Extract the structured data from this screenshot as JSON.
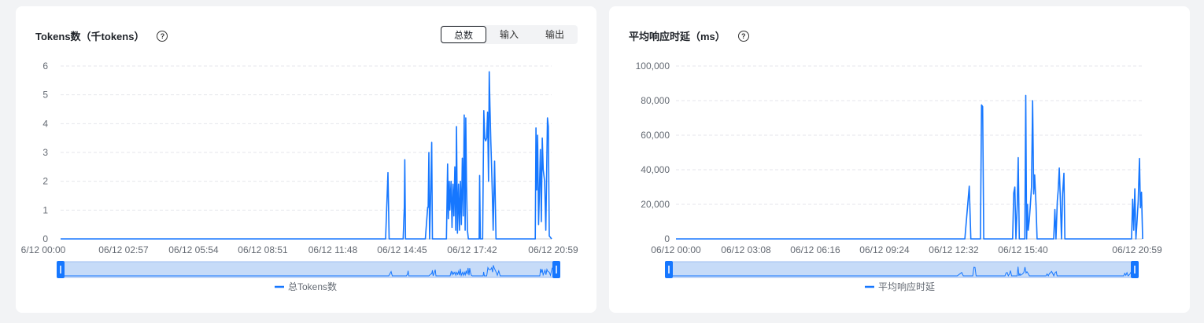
{
  "panels": {
    "tokens": {
      "title": "Tokens数（千tokens）",
      "help_icon": "question-circle-icon",
      "tabs": [
        {
          "label": "总数",
          "active": true
        },
        {
          "label": "输入",
          "active": false
        },
        {
          "label": "输出",
          "active": false
        }
      ]
    },
    "latency": {
      "title": "平均响应时延（ms）",
      "help_icon": "question-circle-icon"
    }
  },
  "colors": {
    "series": "#1677ff",
    "slider_fill": "#c6dbf8",
    "grid": "#e5e6eb"
  },
  "chart_data": [
    {
      "type": "line",
      "title": "Tokens数（千tokens）",
      "xlabel": "",
      "ylabel": "",
      "x_ticks": [
        "6/12 00:00",
        "06/12 02:57",
        "06/12 05:54",
        "06/12 08:51",
        "06/12 11:48",
        "06/12 14:45",
        "06/12 17:42",
        "06/12 20:59"
      ],
      "y_ticks": [
        "0",
        "1",
        "2",
        "3",
        "4",
        "5",
        "6"
      ],
      "ylim": [
        0,
        6
      ],
      "x_range_hours": [
        0,
        21
      ],
      "grid": "dashed-horizontal",
      "legend_position": "bottom",
      "series": [
        {
          "name": "总Tokens数",
          "points": [
            [
              0,
              0
            ],
            [
              13.9,
              0
            ],
            [
              14.0,
              2.3
            ],
            [
              14.05,
              0
            ],
            [
              14.65,
              0
            ],
            [
              14.7,
              1.1
            ],
            [
              14.72,
              2.75
            ],
            [
              14.75,
              0
            ],
            [
              15.6,
              0
            ],
            [
              15.7,
              1.1
            ],
            [
              15.72,
              1.1
            ],
            [
              15.75,
              3.0
            ],
            [
              15.78,
              0
            ],
            [
              15.83,
              1.7
            ],
            [
              15.87,
              3.35
            ],
            [
              15.9,
              0
            ],
            [
              16.5,
              0
            ],
            [
              16.55,
              2.6
            ],
            [
              16.58,
              0.7
            ],
            [
              16.62,
              2.0
            ],
            [
              16.65,
              1.0
            ],
            [
              16.7,
              2.0
            ],
            [
              16.74,
              0.4
            ],
            [
              16.78,
              1.9
            ],
            [
              16.82,
              0.8
            ],
            [
              16.86,
              2.5
            ],
            [
              16.9,
              0.3
            ],
            [
              16.93,
              3.9
            ],
            [
              16.97,
              0.2
            ],
            [
              17.02,
              1.9
            ],
            [
              17.06,
              0.3
            ],
            [
              17.1,
              2.0
            ],
            [
              17.14,
              0.5
            ],
            [
              17.18,
              2.8
            ],
            [
              17.22,
              0.8
            ],
            [
              17.26,
              4.3
            ],
            [
              17.3,
              0.3
            ],
            [
              17.33,
              4.2
            ],
            [
              17.36,
              1.9
            ],
            [
              17.4,
              0.3
            ],
            [
              17.44,
              0
            ],
            [
              17.9,
              0
            ],
            [
              17.92,
              2.2
            ],
            [
              17.95,
              0
            ],
            [
              18.05,
              0
            ],
            [
              18.1,
              4.45
            ],
            [
              18.14,
              3.5
            ],
            [
              18.18,
              3.4
            ],
            [
              18.22,
              3.5
            ],
            [
              18.26,
              4.4
            ],
            [
              18.3,
              2.0
            ],
            [
              18.33,
              5.8
            ],
            [
              18.36,
              4.6
            ],
            [
              18.4,
              3.4
            ],
            [
              18.43,
              2.6
            ],
            [
              18.47,
              1.4
            ],
            [
              18.5,
              0.3
            ],
            [
              18.56,
              2.7
            ],
            [
              18.62,
              0
            ],
            [
              20.3,
              0
            ],
            [
              20.33,
              3.85
            ],
            [
              20.36,
              1.7
            ],
            [
              20.4,
              3.6
            ],
            [
              20.44,
              0.5
            ],
            [
              20.48,
              1.7
            ],
            [
              20.52,
              3.1
            ],
            [
              20.56,
              0.6
            ],
            [
              20.6,
              3.5
            ],
            [
              20.64,
              2.4
            ],
            [
              20.7,
              2.0
            ],
            [
              20.75,
              0.3
            ],
            [
              20.82,
              4.2
            ],
            [
              20.86,
              3.9
            ],
            [
              20.9,
              0.1
            ],
            [
              21,
              0
            ]
          ]
        }
      ]
    },
    {
      "type": "line",
      "title": "平均响应时延（ms）",
      "xlabel": "",
      "ylabel": "",
      "x_ticks": [
        "06/12 00:00",
        "06/12 03:08",
        "06/12 06:16",
        "06/12 09:24",
        "06/12 12:32",
        "06/12 15:40",
        "06/12 20:59"
      ],
      "y_ticks": [
        "0",
        "20,000",
        "40,000",
        "60,000",
        "80,000",
        "100,000"
      ],
      "ylim": [
        0,
        100000
      ],
      "x_range_hours": [
        0,
        21
      ],
      "grid": "dashed-horizontal",
      "legend_position": "bottom",
      "series": [
        {
          "name": "平均响应时延",
          "points": [
            [
              0,
              0
            ],
            [
              13.0,
              0
            ],
            [
              13.2,
              30500
            ],
            [
              13.27,
              0
            ],
            [
              13.7,
              0
            ],
            [
              13.75,
              77500
            ],
            [
              13.8,
              76500
            ],
            [
              13.85,
              0
            ],
            [
              15.15,
              0
            ],
            [
              15.2,
              26500
            ],
            [
              15.25,
              30000
            ],
            [
              15.3,
              0
            ],
            [
              15.36,
              20000
            ],
            [
              15.4,
              47000
            ],
            [
              15.45,
              0
            ],
            [
              15.7,
              0
            ],
            [
              15.74,
              83000
            ],
            [
              15.78,
              0
            ],
            [
              15.82,
              20000
            ],
            [
              15.85,
              5000
            ],
            [
              15.9,
              11000
            ],
            [
              15.94,
              18000
            ],
            [
              16.0,
              30000
            ],
            [
              16.05,
              80000
            ],
            [
              16.1,
              26000
            ],
            [
              16.14,
              37000
            ],
            [
              16.2,
              20000
            ],
            [
              16.25,
              0
            ],
            [
              17.0,
              0
            ],
            [
              17.05,
              17000
            ],
            [
              17.1,
              0
            ],
            [
              17.16,
              22000
            ],
            [
              17.2,
              28000
            ],
            [
              17.25,
              41000
            ],
            [
              17.3,
              22000
            ],
            [
              17.35,
              0
            ],
            [
              17.4,
              26000
            ],
            [
              17.46,
              38000
            ],
            [
              17.5,
              0
            ],
            [
              20.5,
              0
            ],
            [
              20.55,
              23000
            ],
            [
              20.6,
              5000
            ],
            [
              20.65,
              29000
            ],
            [
              20.7,
              0
            ],
            [
              20.75,
              10000
            ],
            [
              20.8,
              22000
            ],
            [
              20.86,
              46500
            ],
            [
              20.9,
              18000
            ],
            [
              20.95,
              27000
            ],
            [
              21,
              0
            ]
          ]
        }
      ]
    }
  ]
}
